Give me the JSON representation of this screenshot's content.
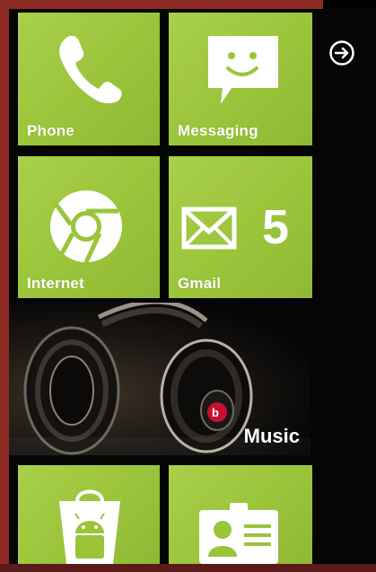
{
  "tiles": {
    "phone": {
      "label": "Phone",
      "icon": "phone-icon"
    },
    "messaging": {
      "label": "Messaging",
      "icon": "smiley-message-icon"
    },
    "internet": {
      "label": "Internet",
      "icon": "chrome-icon"
    },
    "gmail": {
      "label": "Gmail",
      "icon": "mail-icon",
      "count": "5"
    },
    "music": {
      "label": "Music",
      "icon": "headphones-image"
    },
    "market": {
      "icon": "market-bag-icon"
    },
    "contacts": {
      "icon": "contact-card-icon"
    }
  },
  "nav": {
    "icon": "arrow-right-circle-icon"
  },
  "colors": {
    "tile": "#9ac43a",
    "frame": "#8e2a24",
    "background": "#000000"
  }
}
